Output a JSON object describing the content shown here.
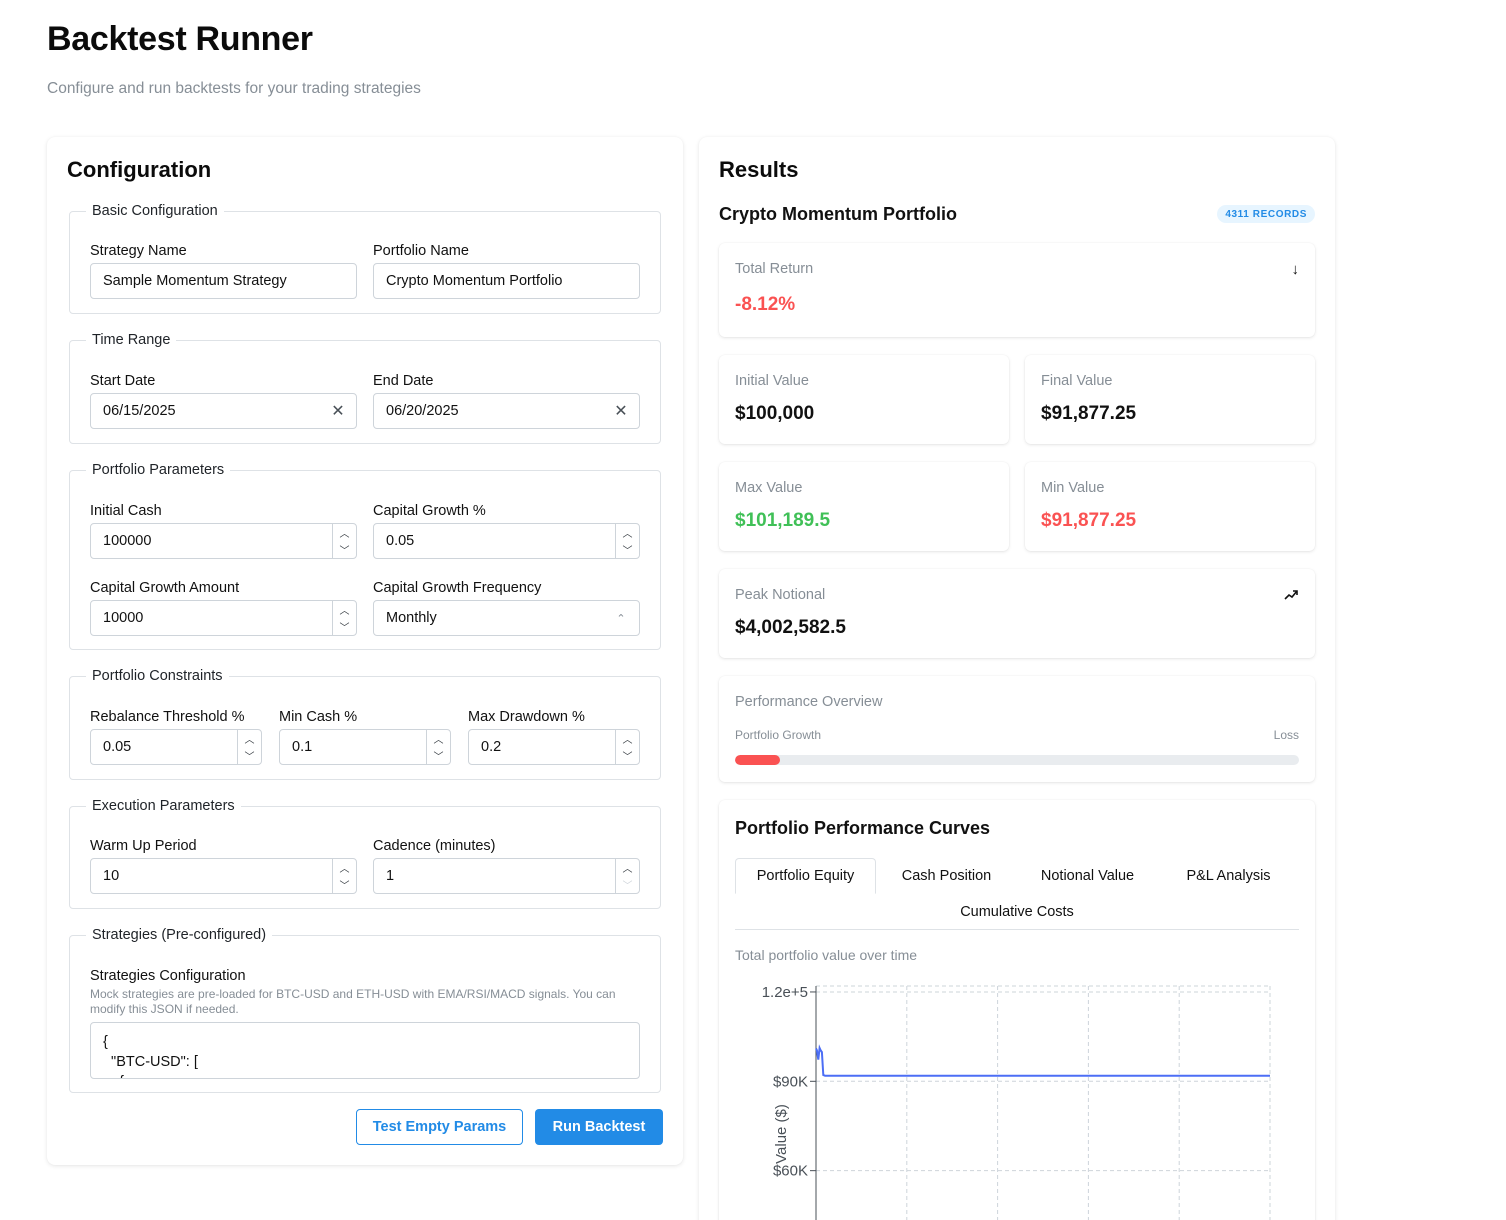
{
  "header": {
    "title": "Backtest Runner",
    "subtitle": "Configure and run backtests for your trading strategies"
  },
  "config": {
    "title": "Configuration",
    "basic": {
      "legend": "Basic Configuration",
      "strategy_label": "Strategy Name",
      "strategy_value": "Sample Momentum Strategy",
      "portfolio_label": "Portfolio Name",
      "portfolio_value": "Crypto Momentum Portfolio"
    },
    "time": {
      "legend": "Time Range",
      "start_label": "Start Date",
      "start_value": "06/15/2025",
      "end_label": "End Date",
      "end_value": "06/20/2025"
    },
    "portfolio_params": {
      "legend": "Portfolio Parameters",
      "initial_cash_label": "Initial Cash",
      "initial_cash_value": "100000",
      "growth_pct_label": "Capital Growth %",
      "growth_pct_value": "0.05",
      "growth_amount_label": "Capital Growth Amount",
      "growth_amount_value": "10000",
      "growth_freq_label": "Capital Growth Frequency",
      "growth_freq_value": "Monthly"
    },
    "constraints": {
      "legend": "Portfolio Constraints",
      "rebalance_label": "Rebalance Threshold %",
      "rebalance_value": "0.05",
      "min_cash_label": "Min Cash %",
      "min_cash_value": "0.1",
      "max_dd_label": "Max Drawdown %",
      "max_dd_value": "0.2"
    },
    "execution": {
      "legend": "Execution Parameters",
      "warmup_label": "Warm Up Period",
      "warmup_value": "10",
      "cadence_label": "Cadence (minutes)",
      "cadence_value": "1"
    },
    "strategies": {
      "legend": "Strategies (Pre-configured)",
      "label": "Strategies Configuration",
      "help": "Mock strategies are pre-loaded for BTC-USD and ETH-USD with EMA/RSI/MACD signals. You can modify this JSON if needed.",
      "json_text": "{\n  \"BTC-USD\": [\n    {"
    },
    "buttons": {
      "test_empty": "Test Empty Params",
      "run": "Run Backtest"
    }
  },
  "results": {
    "title": "Results",
    "portfolio_name": "Crypto Momentum Portfolio",
    "records_badge": "4311 RECORDS",
    "total_return": {
      "label": "Total Return",
      "value": "-8.12%",
      "icon": "arrow-down-icon"
    },
    "initial_value": {
      "label": "Initial Value",
      "value": "$100,000"
    },
    "final_value": {
      "label": "Final Value",
      "value": "$91,877.25"
    },
    "max_value": {
      "label": "Max Value",
      "value": "$101,189.5"
    },
    "min_value": {
      "label": "Min Value",
      "value": "$91,877.25"
    },
    "peak_notional": {
      "label": "Peak Notional",
      "value": "$4,002,582.5",
      "icon": "trending-up-icon"
    },
    "performance": {
      "label": "Performance Overview",
      "left_caption": "Portfolio Growth",
      "right_caption": "Loss",
      "progress_fraction": 0.08
    },
    "curves": {
      "title": "Portfolio Performance Curves",
      "tabs": [
        "Portfolio Equity",
        "Cash Position",
        "Notional Value",
        "P&L Analysis",
        "Cumulative Costs"
      ],
      "active_tab": "Portfolio Equity",
      "description": "Total portfolio value over time"
    }
  },
  "colors": {
    "accent": "#228be6",
    "negative": "#fa5252",
    "positive": "#40c057",
    "line": "#4c6ef5"
  },
  "chart_data": {
    "type": "line",
    "title": "",
    "xlabel": "",
    "ylabel": "Value ($)",
    "y_tick_labels": [
      "1.2e+5",
      "$90K",
      "$60K"
    ],
    "y_ticks": [
      120000,
      90000,
      60000
    ],
    "ylim": [
      30000,
      122000
    ],
    "grid": true,
    "x": [
      0,
      0.2,
      0.5,
      0.8,
      1.0,
      1.3,
      1.6,
      2,
      5,
      10,
      20,
      30,
      40,
      50,
      60,
      70,
      80,
      90,
      100
    ],
    "series": [
      {
        "values": [
          101000,
          100400,
          97300,
          101189.5,
          100500,
          99800,
          92100,
          91877.25,
          91877.25,
          91877.25,
          91877.25,
          91877.25,
          91877.25,
          91877.25,
          91877.25,
          91877.25,
          91877.25,
          91877.25,
          91877.25
        ]
      }
    ]
  }
}
